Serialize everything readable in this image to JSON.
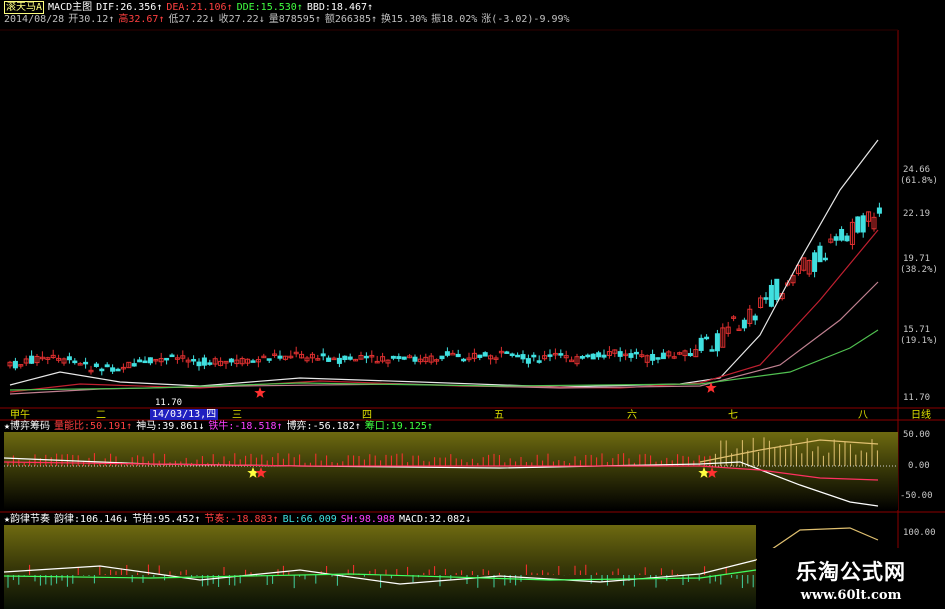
{
  "colors": {
    "bg": "#000000",
    "up": "#e03030",
    "down": "#40e0e0",
    "ma_white": "#e8e8e8",
    "ma_red": "#c02030",
    "ma_pink": "#c08090",
    "ma_green": "#50c050",
    "grid": "#8b0000",
    "panel_fill": "#6b6b10",
    "yellow": "#ffff40",
    "cyan": "#40e0e0",
    "magenta": "#ff40ff",
    "white": "#ffffff",
    "red": "#ff3030"
  },
  "main_panel": {
    "title_items": [
      {
        "text": "滚天马A",
        "color": "#ffff80",
        "boxed": true
      },
      {
        "text": "MACD主图",
        "color": "#ffffff"
      },
      {
        "text": "DIF:26.356↑",
        "color": "#ffffff"
      },
      {
        "text": "DEA:21.106↑",
        "color": "#ff4040"
      },
      {
        "text": "DDE:15.530↑",
        "color": "#40ff40"
      },
      {
        "text": "BBD:18.467↑",
        "color": "#ffffff"
      }
    ],
    "info_items": [
      {
        "text": "2014/08/28",
        "color": "#c0c0c0"
      },
      {
        "text": "开30.12↑",
        "color": "#c0c0c0"
      },
      {
        "text": "高32.67↑",
        "color": "#ff4040"
      },
      {
        "text": "低27.22↓",
        "color": "#c0c0c0"
      },
      {
        "text": "收27.22↓",
        "color": "#c0c0c0"
      },
      {
        "text": "量878595↑",
        "color": "#c0c0c0"
      },
      {
        "text": "额266385↑",
        "color": "#c0c0c0"
      },
      {
        "text": "换15.30%",
        "color": "#c0c0c0"
      },
      {
        "text": "振18.02%",
        "color": "#c0c0c0"
      },
      {
        "text": "涨(-3.02)-9.99%",
        "color": "#c0c0c0"
      }
    ],
    "price_labels": [
      "24.66",
      "(61.8%)",
      "22.19",
      "19.71",
      "(38.2%)",
      "15.71",
      "(19.1%)",
      "11.70"
    ],
    "low_marker": "11.70",
    "time_labels": [
      "甲午",
      "二",
      "14/03/13,四",
      "三",
      "四",
      "五",
      "六",
      "七",
      "八",
      "日线"
    ]
  },
  "chip_panel": {
    "title": "★博弈筹码",
    "items": [
      {
        "text": "量能比:50.191↑",
        "color": "#ff4040"
      },
      {
        "text": "神马:39.861↓",
        "color": "#ffffff"
      },
      {
        "text": "铁牛:-18.518↑",
        "color": "#ff40ff"
      },
      {
        "text": "博弈:-56.182↑",
        "color": "#ffffff"
      },
      {
        "text": "筹口:19.125↑",
        "color": "#40ff40"
      }
    ],
    "axis_labels": [
      "50.00",
      "0.00",
      "-50.00"
    ]
  },
  "rhythm_panel": {
    "title": "★韵律节奏",
    "items": [
      {
        "text": "韵律:106.146↓",
        "color": "#ffffff"
      },
      {
        "text": "节拍:95.452↑",
        "color": "#ffffff"
      },
      {
        "text": "节奏:-18.883↑",
        "color": "#ff4040"
      },
      {
        "text": "BL:66.009",
        "color": "#40e0e0"
      },
      {
        "text": "SH:98.988",
        "color": "#ff40ff"
      },
      {
        "text": "MACD:32.082↓",
        "color": "#ffffff"
      }
    ],
    "axis_labels": [
      "100.00"
    ]
  },
  "watermark": {
    "title": "乐淘公式网",
    "url": "www.60lt.com"
  }
}
